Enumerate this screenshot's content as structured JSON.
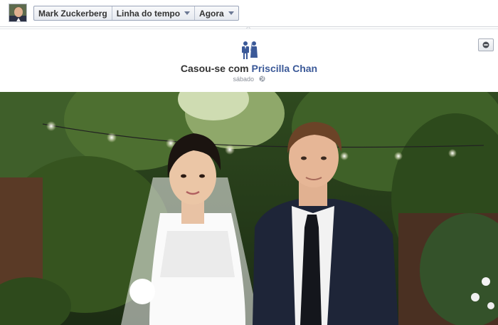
{
  "nav": {
    "profile_name": "Mark Zuckerberg",
    "timeline_label": "Linha do tempo",
    "date_label": "Agora"
  },
  "event": {
    "title_prefix": "Casou-se com",
    "partner_name": "Priscilla Chan",
    "day": "sábado",
    "icon": "wedding-couple-icon",
    "privacy_icon": "globe-icon"
  },
  "colors": {
    "link_blue": "#3b5998",
    "meta_gray": "#8a8f99"
  }
}
